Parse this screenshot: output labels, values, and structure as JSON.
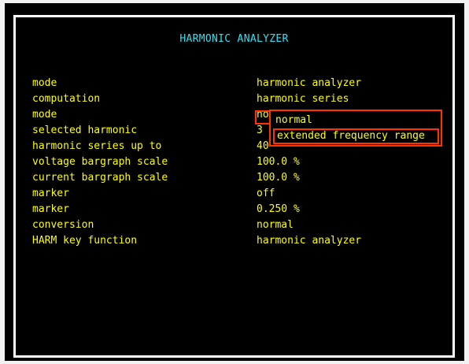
{
  "title": "HARMONIC ANALYZER",
  "rows": [
    {
      "param": "mode",
      "value": "harmonic analyzer"
    },
    {
      "param": "computation",
      "value": "harmonic series"
    },
    {
      "param": "mode",
      "value": "normal"
    },
    {
      "param": "selected harmonic",
      "value": "3"
    },
    {
      "param": "harmonic series up to",
      "value": "40"
    },
    {
      "param": "voltage bargraph scale",
      "value": "100.0 %"
    },
    {
      "param": "current bargraph scale",
      "value": "100.0 %"
    },
    {
      "param": "marker",
      "value": "off"
    },
    {
      "param": "marker",
      "value": "0.250 %"
    },
    {
      "param": "conversion",
      "value": "normal"
    },
    {
      "param": "HARM key function",
      "value": "harmonic analyzer"
    }
  ],
  "popup": {
    "options": [
      "normal",
      "extended frequency range"
    ],
    "highlighted": "extended frequency range"
  },
  "colors": {
    "background": "#000000",
    "text": "#ffff00",
    "title": "#32e0f0",
    "highlight": "#ff3300",
    "border": "#ffffff"
  }
}
